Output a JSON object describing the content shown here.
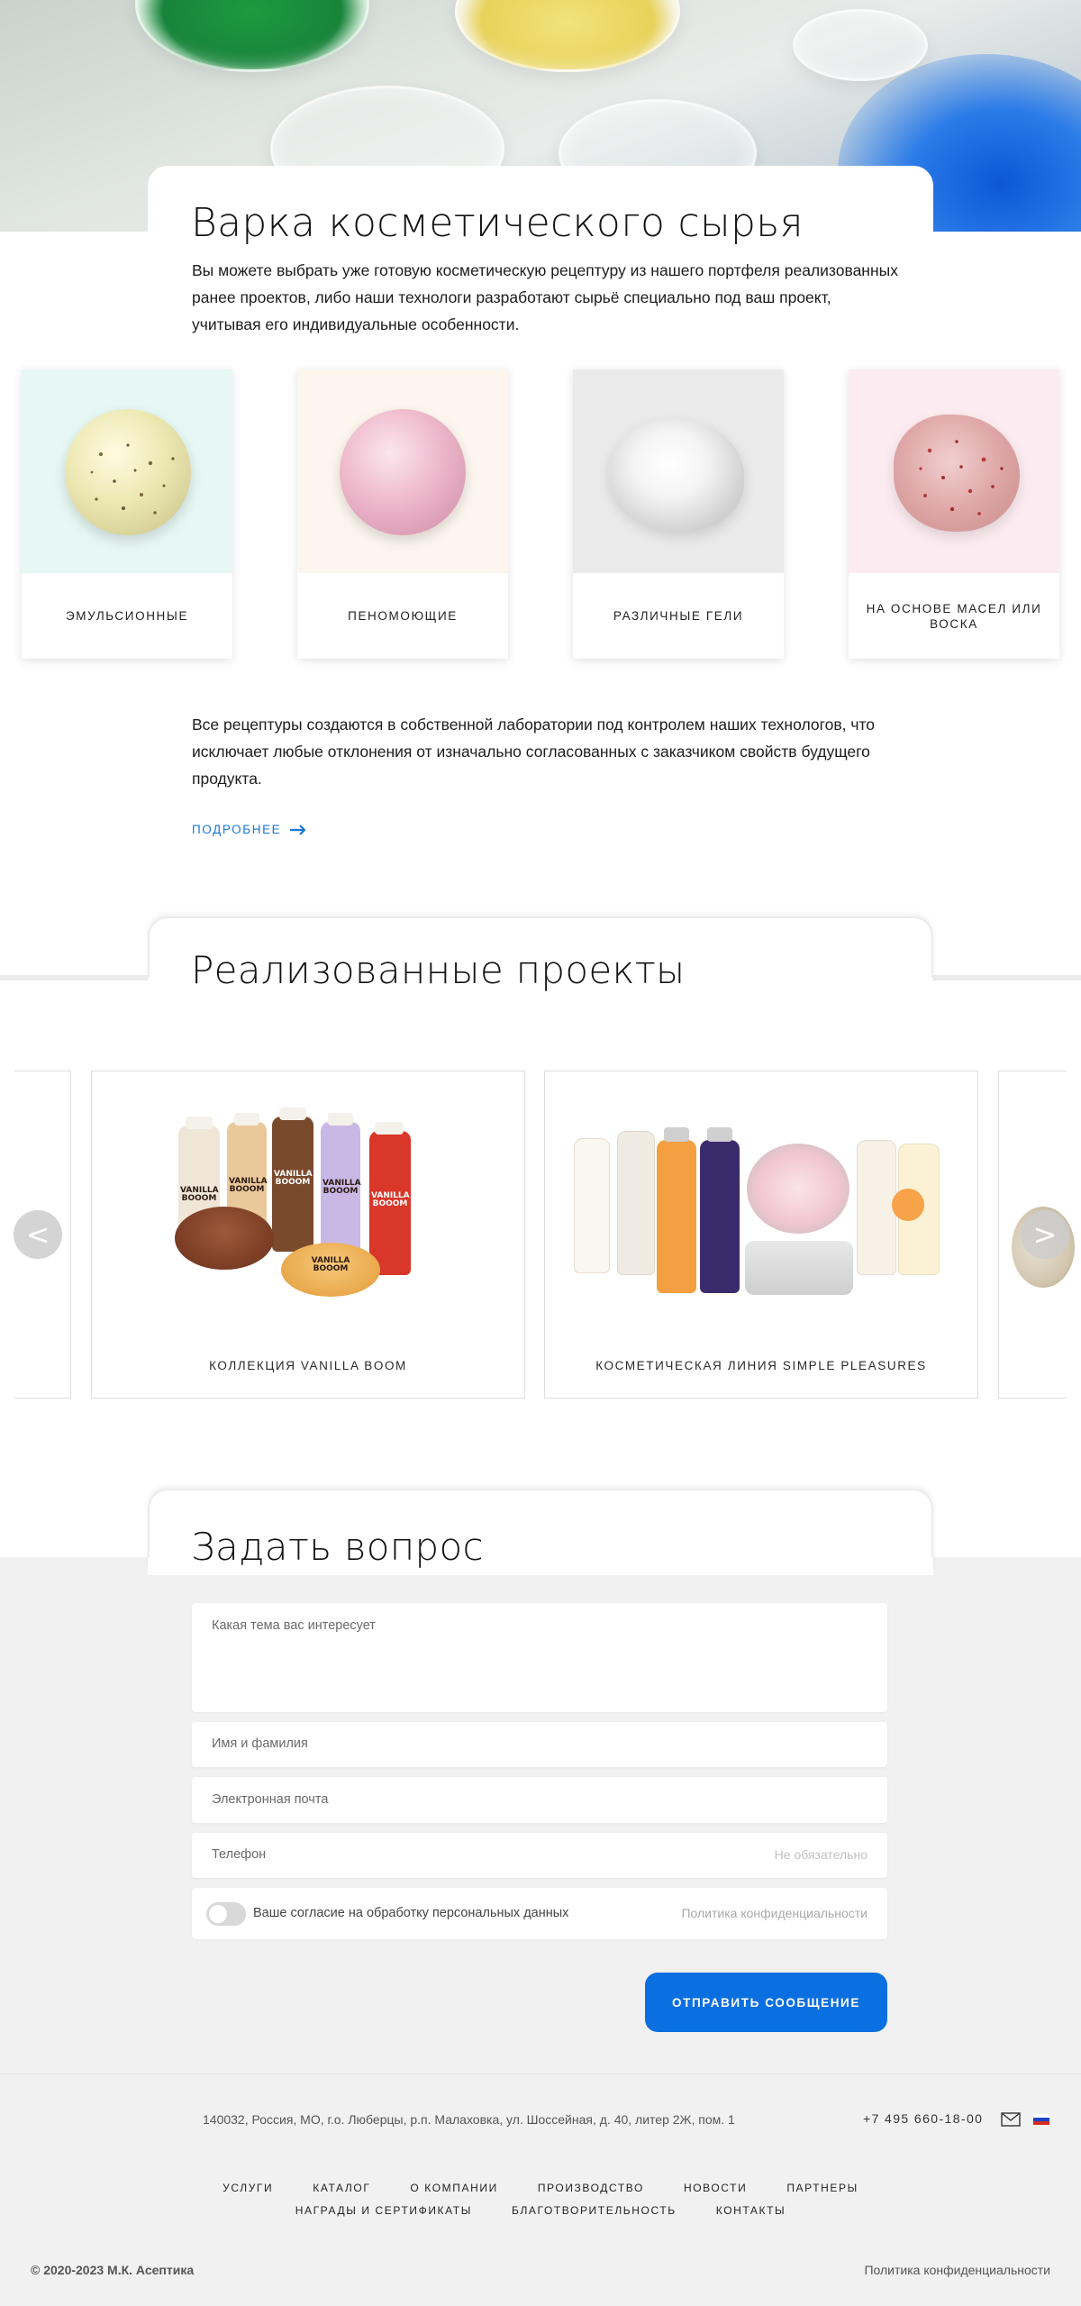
{
  "hero": {
    "image_alt": "petri-dishes-photo"
  },
  "cooking": {
    "title": "Варка косметического сырья",
    "intro": "Вы можете выбрать уже готовую косметическую рецептуру из нашего портфеля реализованных ранее проектов, либо наши технологи разработают сырьё специально под ваш проект, учитывая его индивидуальные особенности.",
    "types": [
      {
        "label": "ЭМУЛЬСИОННЫЕ",
        "bg": "#e7f7f4"
      },
      {
        "label": "ПЕНОМОЮЩИЕ",
        "bg": "#fcf6ee"
      },
      {
        "label": "РАЗЛИЧНЫЕ ГЕЛИ",
        "bg": "#eaeaea"
      },
      {
        "label": "НА ОСНОВЕ МАСЕЛ ИЛИ ВОСКА",
        "bg": "#fcecf1"
      }
    ],
    "body": "Все рецептуры создаются в собственной лаборатории под контролем наших технологов, что исключает любые отклонения от изначально согласованных с заказчиком свойств будущего продукта.",
    "more_label": "ПОДРОБНЕЕ"
  },
  "projects": {
    "title": "Реализованные проекты",
    "items": [
      {
        "label": "КОЛЛЕКЦИЯ VANILLA BOOM"
      },
      {
        "label": "КОСМЕТИЧЕСКАЯ ЛИНИЯ SIMPLE PLEASURES"
      }
    ],
    "brand_text": "VANILLA BOOOM",
    "prev_label": "<",
    "next_label": ">"
  },
  "question": {
    "title": "Задать вопрос",
    "topic_label": "Какая тема вас интересует",
    "name_label": "Имя и фамилия",
    "email_label": "Электронная почта",
    "phone_label": "Телефон",
    "phone_hint": "Не обязательно",
    "consent_label": "Ваше согласие на обработку персональных данных",
    "policy_link": "Политика конфиденциальности",
    "submit_label": "ОТПРАВИТЬ СООБЩЕНИЕ"
  },
  "footer": {
    "address": "140032, Россия, МО, г.о. Люберцы, р.п. Малаховка, ул. Шоссейная, д. 40, литер 2Ж, пом. 1",
    "phone": "+7 495 660-18-00",
    "nav_row1": [
      "УСЛУГИ",
      "КАТАЛОГ",
      "О КОМПАНИИ",
      "ПРОИЗВОДСТВО",
      "НОВОСТИ",
      "ПАРТНЕРЫ"
    ],
    "nav_row2": [
      "НАГРАДЫ И СЕРТИФИКАТЫ",
      "БЛАГОТВОРИТЕЛЬНОСТЬ",
      "КОНТАКТЫ"
    ],
    "copyright": "© 2020-2023 М.К. Асептика",
    "privacy": "Политика конфиденциальности",
    "icons": [
      "mail-icon",
      "russian-flag-icon"
    ]
  },
  "colors": {
    "accent": "#0a6fe0",
    "link": "#1a78d6",
    "gray_bg": "#f1f1f1"
  }
}
